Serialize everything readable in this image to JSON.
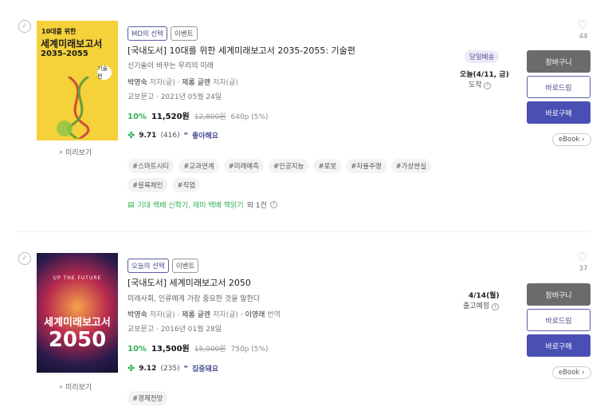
{
  "items": [
    {
      "badges": [
        "MD의 선택",
        "이벤트"
      ],
      "title": "[국내도서] 10대를 위한 세계미래보고서 2035-2055: 기술편",
      "subtitle": "신기술이 바꾸는 우리의 미래",
      "author1": "박영숙",
      "author1_role": "저자(글)",
      "author2": "제롬 글렌",
      "author2_role": "저자(글)",
      "sep": "·",
      "publisher_date": "교보문고 · 2021년 05월 24일",
      "discount": "10%",
      "sale_price": "11,520원",
      "orig_price": "12,800원",
      "pages": "640p (5%)",
      "rating": "9.71",
      "rating_count": "(416)",
      "reaction": "좋아해요",
      "tags": [
        "#스마트시티",
        "#교과연계",
        "#미래예측",
        "#인공지능",
        "#로봇",
        "#자율주행",
        "#가상현실",
        "#블록체인",
        "#직업"
      ],
      "promo": "기대 백배 신학기, 재미 백배 책읽기",
      "promo_count": "외 1건",
      "delivery_badge": "당일배송",
      "delivery_date": "오늘(4/11, 금)",
      "delivery_status": "도착",
      "likes": "44",
      "cover_top": "10대를 위한",
      "cover_title": "세계미래보고서",
      "cover_years": "2035-2055",
      "cover_tag": "기술편"
    },
    {
      "badges": [
        "오늘의 선택",
        "이벤트"
      ],
      "title": "[국내도서] 세계미래보고서 2050",
      "subtitle": "미래사회, 인류에게 가장 중요한 것을 말한다",
      "author1": "박영숙",
      "author1_role": "저자(글)",
      "author2": "제롬 글렌",
      "author2_role": "저자(글)",
      "author3": "이영래",
      "author3_role": "번역",
      "sep": "·",
      "publisher_date": "교보문고 · 2016년 01월 28일",
      "discount": "10%",
      "sale_price": "13,500원",
      "orig_price": "15,000원",
      "pages": "750p (5%)",
      "rating": "9.12",
      "rating_count": "(235)",
      "reaction": "집중돼요",
      "tags": [
        "#경제전망"
      ],
      "delivery_date": "4/14(월)",
      "delivery_status": "출고예정",
      "likes": "37",
      "cover_sub": "UP THE FUTURE",
      "cover_title": "세계미래보고서",
      "cover_year": "2050"
    }
  ],
  "buttons": {
    "cart": "장바구니",
    "gift": "바로드림",
    "buy": "바로구매",
    "ebook": "eBook"
  },
  "preview": "미리보기",
  "colors": {
    "accent": "#4a4fb3",
    "green": "#2fb04f"
  }
}
